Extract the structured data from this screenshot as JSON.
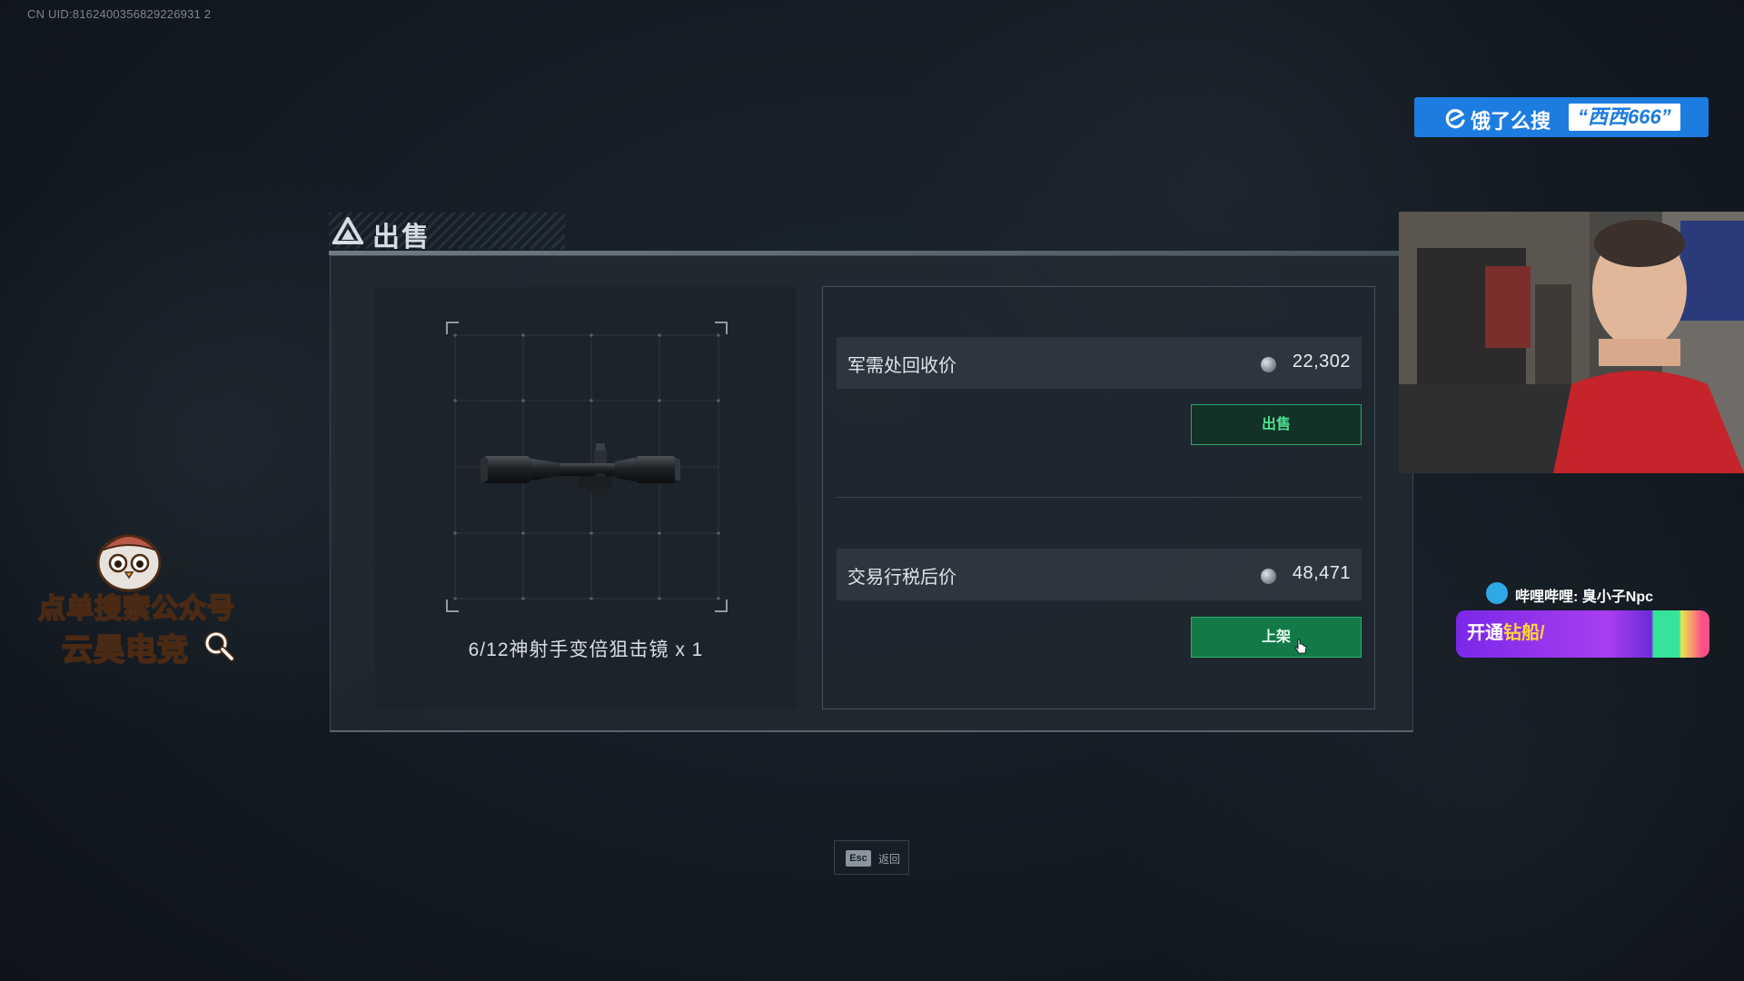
{
  "overlay": {
    "uid": "CN UID:8162400356829226931 2"
  },
  "dialog": {
    "title": "出售",
    "item": {
      "name_with_qty": "6/12神射手变倍狙击镜 x 1"
    },
    "recycle": {
      "label": "军需处回收价",
      "price": "22,302",
      "button": "出售"
    },
    "market": {
      "label": "交易行税后价",
      "price": "48,471",
      "button": "上架"
    },
    "esc": {
      "key": "Esc",
      "label": "返回"
    }
  },
  "stream_overlays": {
    "promo": {
      "text": "饿了么搜",
      "highlight": "“西西666”"
    },
    "wechat": {
      "line1": "点单搜索公众号",
      "line2": "云昊电竞"
    },
    "bilibili": {
      "label": "哔哩哔哩: 臭小子Npc"
    },
    "fan_badge": {
      "text_a": "开通",
      "text_b": "钻船/"
    }
  },
  "colors": {
    "accent_green": "#137a47",
    "sell_green": "#4ee08e",
    "promo_blue": "#1d7ce0"
  }
}
